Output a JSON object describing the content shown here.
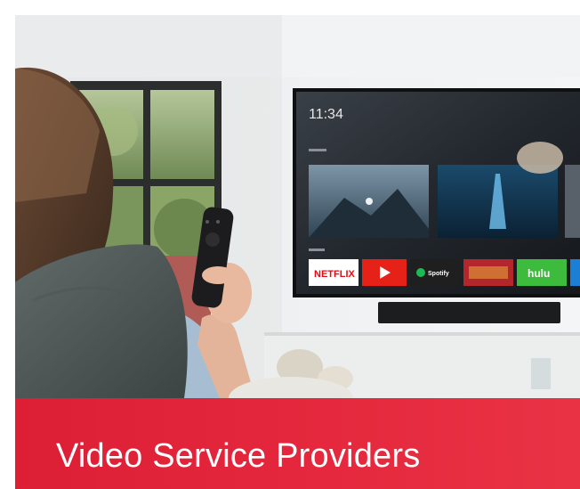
{
  "banner": {
    "title": "Video Service Providers"
  },
  "tv": {
    "clock": "11:34",
    "row_label_top": "",
    "row_label_apps": "",
    "apps": [
      {
        "name": "NETFLIX",
        "color": "#e50914"
      },
      {
        "name": "",
        "icon": "play-icon",
        "color": "#e62117"
      },
      {
        "name": "Spotify",
        "color": "#1f1f1f"
      },
      {
        "name": "",
        "icon": "movie-art",
        "color": "#b3262c"
      },
      {
        "name": "hulu",
        "color": "#3dbb3d"
      },
      {
        "name": "",
        "icon": "app-tile",
        "color": "#1c7fd6"
      }
    ]
  },
  "colors": {
    "banner_red": "#e5283d",
    "banner_text": "#ffffff"
  }
}
